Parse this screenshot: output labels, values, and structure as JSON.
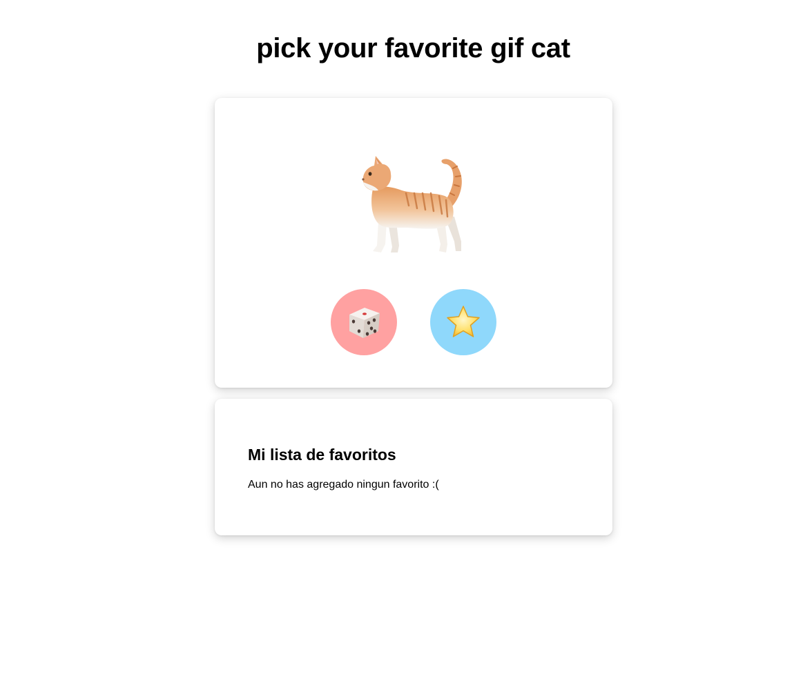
{
  "page": {
    "title": "pick your favorite gif cat"
  },
  "cat_card": {
    "image_icon": "cat-icon",
    "random_button": {
      "icon": "dice-icon",
      "color": "#ffa1a1"
    },
    "favorite_button": {
      "icon": "star-icon",
      "color": "#8fd8fb"
    }
  },
  "favorites": {
    "heading": "Mi lista de favoritos",
    "empty_message": "Aun no has agregado ningun favorito :("
  }
}
